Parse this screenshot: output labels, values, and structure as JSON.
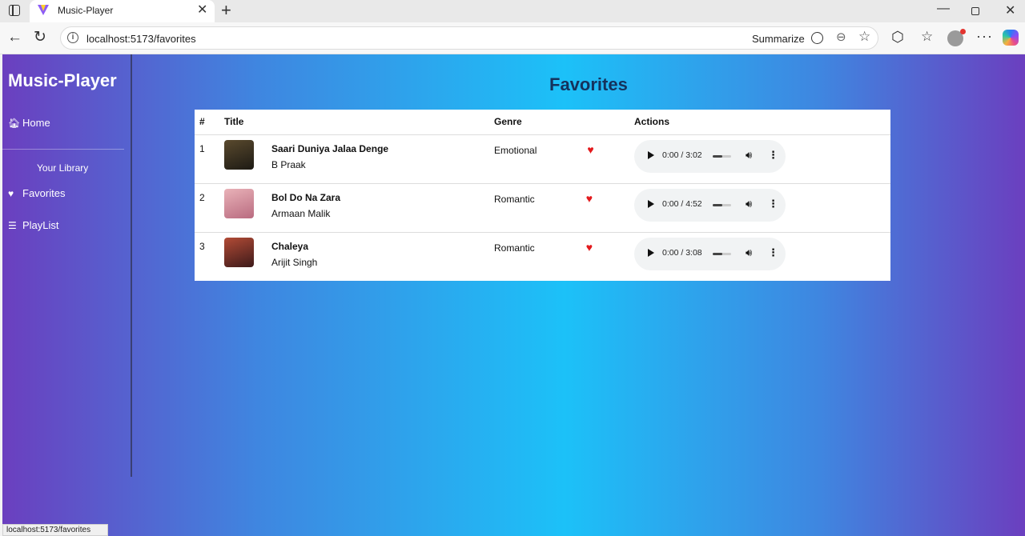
{
  "browser": {
    "tab_title": "Music-Player",
    "url": "localhost:5173/favorites",
    "summarize_label": "Summarize",
    "status_url": "localhost:5173/favorites"
  },
  "sidebar": {
    "brand": "Music-Player",
    "home": "Home",
    "section": "Your Library",
    "favorites": "Favorites",
    "playlist": "PlayList"
  },
  "main": {
    "title": "Favorites",
    "columns": [
      "#",
      "Title",
      "Genre",
      "Actions"
    ],
    "rows": [
      {
        "num": "1",
        "title": "Saari Duniya Jalaa Denge",
        "artist": "B Praak",
        "genre": "Emotional",
        "time": "0:00 / 3:02",
        "cover": "#2a2318"
      },
      {
        "num": "2",
        "title": "Bol Do Na Zara",
        "artist": "Armaan Malik",
        "genre": "Romantic",
        "time": "0:00 / 4:52",
        "cover": "#d98a9a"
      },
      {
        "num": "3",
        "title": "Chaleya",
        "artist": "Arijit Singh",
        "genre": "Romantic",
        "time": "0:00 / 3:08",
        "cover": "#7a2f2a"
      }
    ]
  },
  "icons": {
    "home": "home-icon",
    "heart": "heart-icon",
    "list": "list-icon"
  },
  "colors": {
    "gradient_edge": "#6b3fbf",
    "gradient_center": "#1cc1f8",
    "heart": "#e3191c",
    "title_text": "#15325c"
  }
}
